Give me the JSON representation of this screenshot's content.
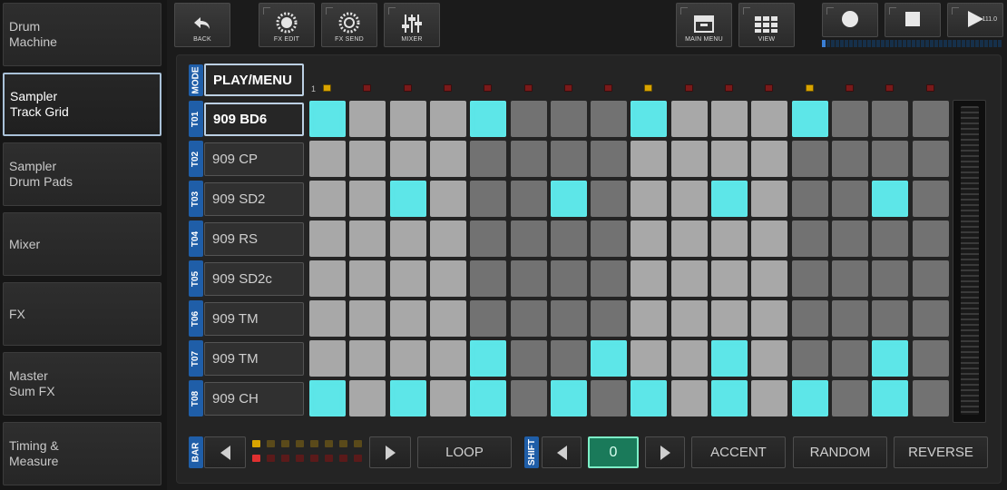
{
  "sidebar": {
    "items": [
      {
        "label": "Drum\nMachine",
        "active": false
      },
      {
        "label": "Sampler\nTrack Grid",
        "active": true
      },
      {
        "label": "Sampler\nDrum Pads",
        "active": false
      },
      {
        "label": "Mixer",
        "active": false
      },
      {
        "label": "FX",
        "active": false
      },
      {
        "label": "Master\nSum FX",
        "active": false
      },
      {
        "label": "Timing &\nMeasure",
        "active": false
      }
    ]
  },
  "toolbar": {
    "back_label": "BACK",
    "fx_edit_label": "FX EDIT",
    "fx_send_label": "FX SEND",
    "mixer_label": "MIXER",
    "main_menu_label": "MAIN MENU",
    "view_label": "VIEW",
    "tempo": "111.0"
  },
  "mode": {
    "label": "MODE",
    "value": "PLAY/MENU"
  },
  "step_indicator": {
    "first_step_number": "1",
    "playing_steps": [
      1,
      9,
      13
    ]
  },
  "tracks": [
    {
      "id": "T01",
      "name": "909 BD6",
      "selected": true,
      "steps": [
        1,
        0,
        0,
        0,
        1,
        0,
        0,
        0,
        1,
        0,
        0,
        0,
        1,
        0,
        0,
        0
      ]
    },
    {
      "id": "T02",
      "name": "909 CP",
      "selected": false,
      "steps": [
        0,
        0,
        0,
        0,
        0,
        0,
        0,
        0,
        0,
        0,
        0,
        0,
        0,
        0,
        0,
        0
      ]
    },
    {
      "id": "T03",
      "name": "909 SD2",
      "selected": false,
      "steps": [
        0,
        0,
        1,
        0,
        0,
        0,
        1,
        0,
        0,
        0,
        1,
        0,
        0,
        0,
        1,
        0
      ]
    },
    {
      "id": "T04",
      "name": "909 RS",
      "selected": false,
      "steps": [
        0,
        0,
        0,
        0,
        0,
        0,
        0,
        0,
        0,
        0,
        0,
        0,
        0,
        0,
        0,
        0
      ]
    },
    {
      "id": "T05",
      "name": "909 SD2c",
      "selected": false,
      "steps": [
        0,
        0,
        0,
        0,
        0,
        0,
        0,
        0,
        0,
        0,
        0,
        0,
        0,
        0,
        0,
        0
      ]
    },
    {
      "id": "T06",
      "name": "909 TM",
      "selected": false,
      "steps": [
        0,
        0,
        0,
        0,
        0,
        0,
        0,
        0,
        0,
        0,
        0,
        0,
        0,
        0,
        0,
        0
      ]
    },
    {
      "id": "T07",
      "name": "909 TM",
      "selected": false,
      "steps": [
        0,
        0,
        0,
        0,
        1,
        0,
        0,
        1,
        0,
        0,
        1,
        0,
        0,
        0,
        1,
        0
      ]
    },
    {
      "id": "T08",
      "name": "909 CH",
      "selected": false,
      "steps": [
        1,
        0,
        1,
        0,
        1,
        0,
        1,
        0,
        1,
        0,
        1,
        0,
        1,
        0,
        1,
        0
      ]
    }
  ],
  "bottom": {
    "bar_label": "BAR",
    "loop_label": "LOOP",
    "shift_label": "SHIFT",
    "shift_value": "0",
    "accent_label": "ACCENT",
    "random_label": "RANDOM",
    "reverse_label": "REVERSE",
    "bar_leds_top": [
      1,
      0,
      0,
      0,
      0,
      0,
      0,
      0
    ],
    "bar_leds_bottom": [
      1,
      0,
      0,
      0,
      0,
      0,
      0,
      0
    ]
  },
  "colors": {
    "step_on": "#5de6e8",
    "step_off_light": "#a8a8a8",
    "step_off_dark": "#727272",
    "label_blue": "#1f5ea8",
    "led_playing": "#d9a400",
    "led_idle": "#7a1a1a",
    "meter_on": "#3a7fd6"
  },
  "icons": {
    "back": "back-arrow-icon",
    "fx_edit": "fx-wheel-icon",
    "fx_send": "fx-send-wheel-icon",
    "mixer": "mixer-faders-icon",
    "main_menu": "drawer-box-icon",
    "view": "grid-view-icon",
    "record": "record-circle-icon",
    "stop": "stop-square-icon",
    "play": "play-triangle-icon"
  }
}
